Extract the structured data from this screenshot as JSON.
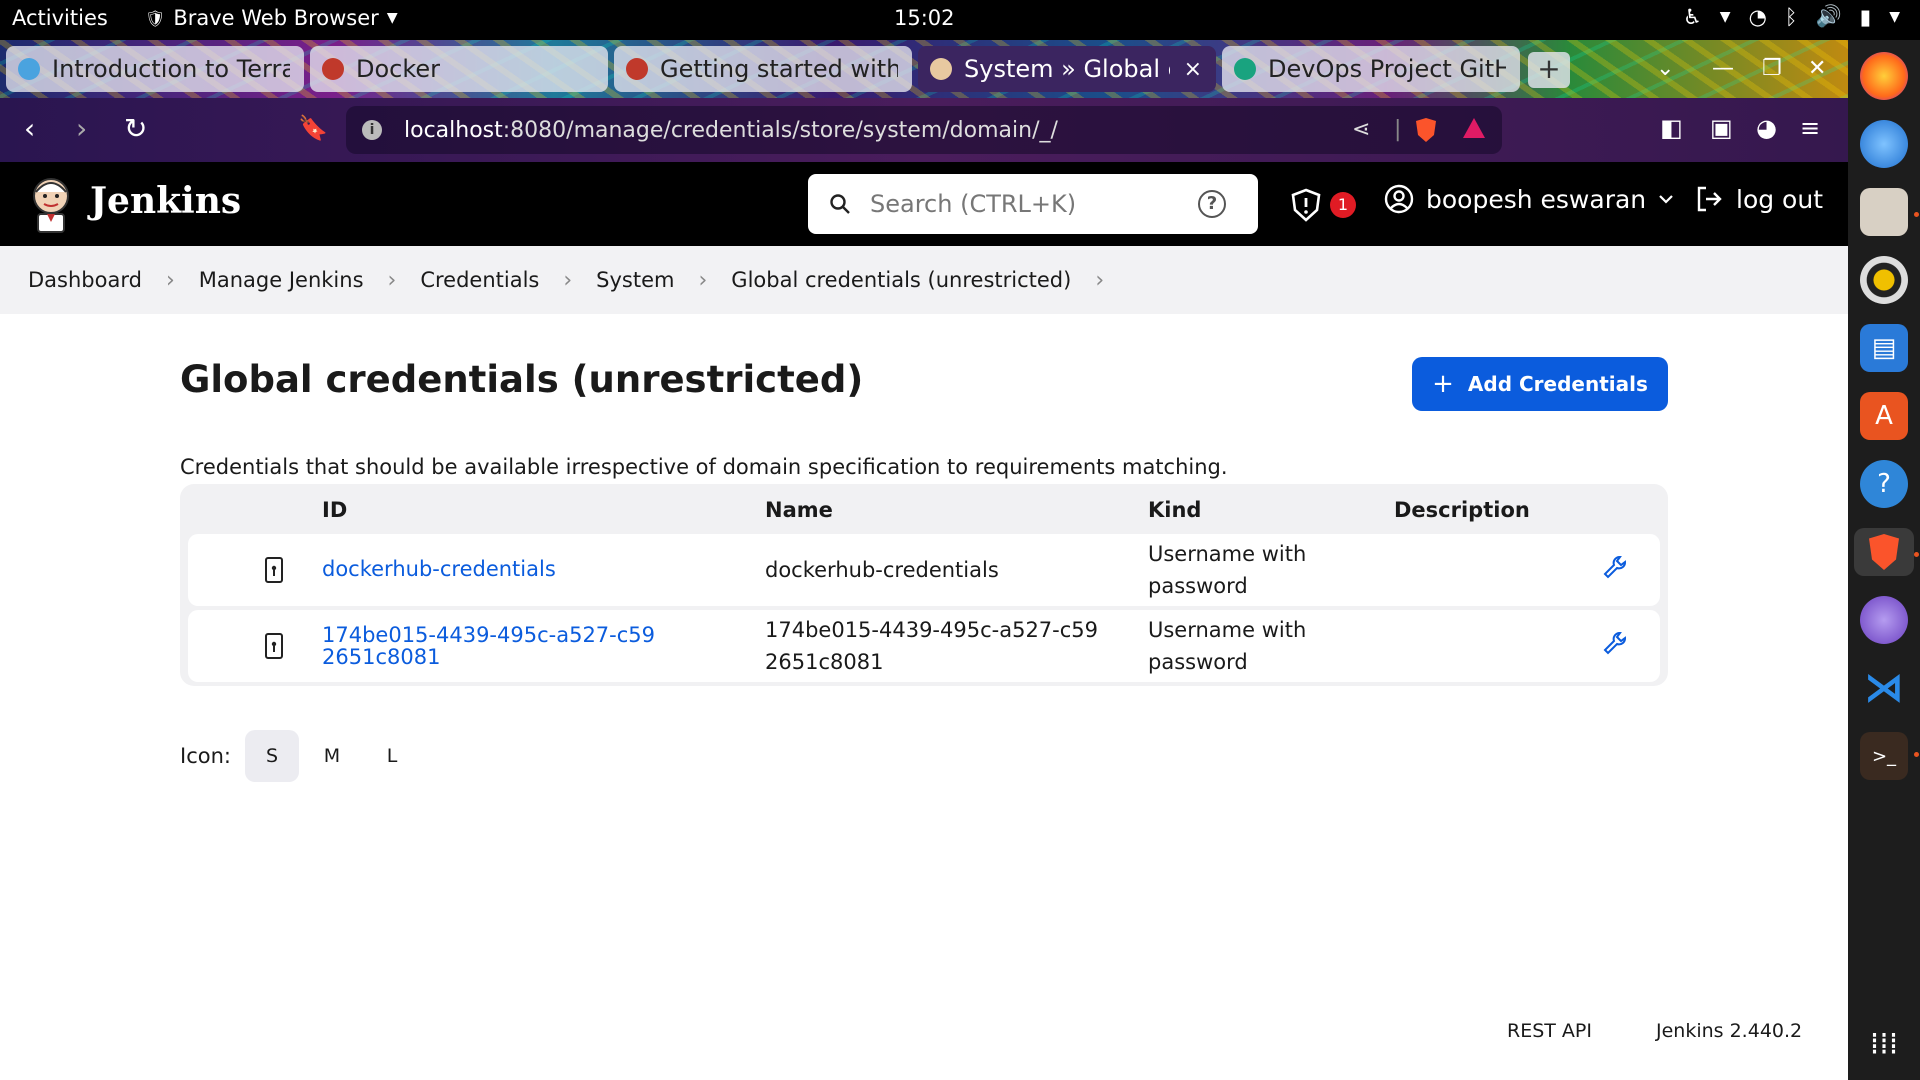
{
  "system_bar": {
    "activities": "Activities",
    "app_menu": "Brave Web Browser",
    "clock": "15:02"
  },
  "browser": {
    "tabs": [
      {
        "title": "Introduction to Terra",
        "active": false
      },
      {
        "title": "Docker",
        "active": false
      },
      {
        "title": "Getting started with",
        "active": false
      },
      {
        "title": "System » Global c",
        "active": true
      },
      {
        "title": "DevOps Project GitH",
        "active": false
      }
    ],
    "new_tab": "+",
    "close_tab": "×",
    "url_host": "localhost",
    "url_path": ":8080/manage/credentials/store/system/domain/_/"
  },
  "jenkins": {
    "title": "Jenkins",
    "search_placeholder": "Search (CTRL+K)",
    "help": "?",
    "security_count": "1",
    "user_name": "boopesh eswaran",
    "logout": "log out"
  },
  "breadcrumb": [
    "Dashboard",
    "Manage Jenkins",
    "Credentials",
    "System",
    "Global credentials (unrestricted)"
  ],
  "page": {
    "title": "Global credentials (unrestricted)",
    "add_button": "Add Credentials",
    "description": "Credentials that should be available irrespective of domain specification to requirements matching."
  },
  "table": {
    "headers": [
      "ID",
      "Name",
      "Kind",
      "Description"
    ],
    "rows": [
      {
        "id": "dockerhub-credentials",
        "name": "dockerhub-credentials",
        "kind": "Username with password",
        "description": ""
      },
      {
        "id": "174be015-4439-495c-a527-c592651c8081",
        "name": "174be015-4439-495c-a527-c592651c8081",
        "kind": "Username with password",
        "description": ""
      }
    ]
  },
  "icon_size": {
    "label": "Icon:",
    "options": [
      "S",
      "M",
      "L"
    ],
    "selected": "S"
  },
  "footer": {
    "rest_api": "REST API",
    "version": "Jenkins 2.440.2"
  },
  "colors": {
    "accent": "#0b5cdd",
    "header_bg": "#000000",
    "breadcrumb_bg": "#f2f2f4",
    "badge": "#e01b24"
  }
}
